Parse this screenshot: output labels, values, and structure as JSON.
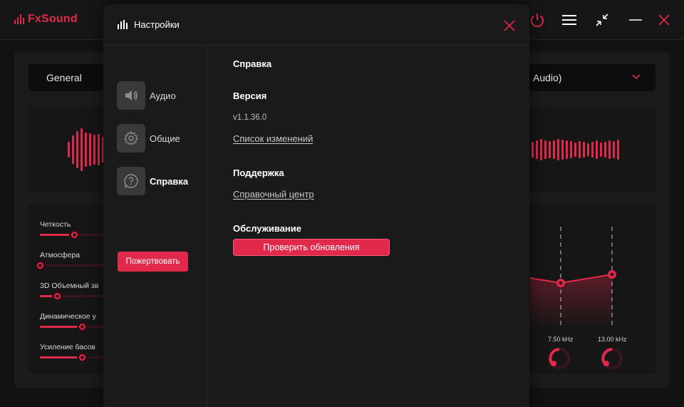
{
  "app": {
    "brand": "FxSound",
    "preset": "General",
    "device": "Audio)",
    "colors": {
      "accent": "#e1294b",
      "bg": "#121212",
      "panel": "#1b1b1b"
    },
    "effects": [
      {
        "label": "Четкость",
        "value": 0.53
      },
      {
        "label": "Атмосфера",
        "value": 0.0
      },
      {
        "label": "3D Объемный зв",
        "value": 0.27
      },
      {
        "label": "Динамическое у",
        "value": 0.66
      },
      {
        "label": "Усиление басов",
        "value": 0.66
      }
    ],
    "eq_bands": [
      {
        "freq": "7.50 kHz"
      },
      {
        "freq": "13.00 kHz"
      }
    ]
  },
  "modal": {
    "title": "Настройки",
    "nav": [
      {
        "label": "Аудио",
        "icon": "speaker-icon"
      },
      {
        "label": "Общие",
        "icon": "gear-icon"
      },
      {
        "label": "Справка",
        "icon": "help-icon",
        "active": true
      }
    ],
    "donate_label": "Пожертвовать",
    "content": {
      "section_title": "Справка",
      "version_title": "Версия",
      "version_value": "v1.1.36.0",
      "changelog_link": "Список изменений",
      "support_title": "Поддержка",
      "help_center_link": "Справочный центр",
      "maintenance_title": "Обслуживание",
      "check_updates_label": "Проверить обновления"
    }
  }
}
